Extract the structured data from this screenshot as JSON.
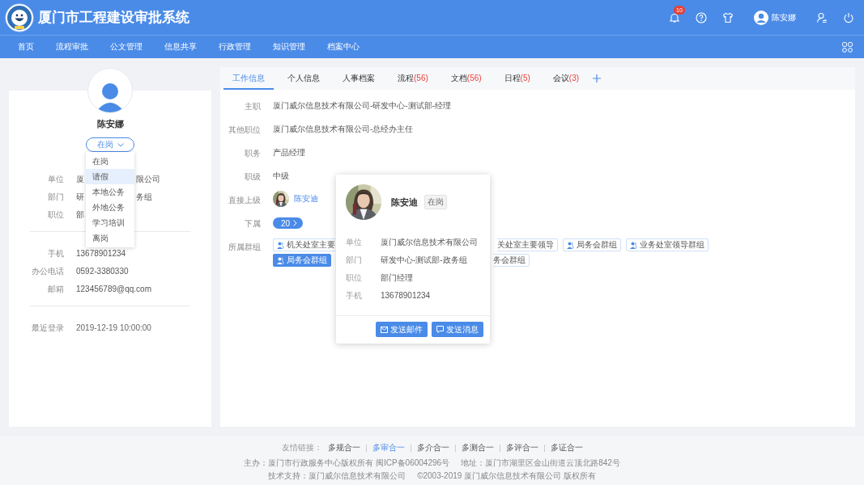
{
  "header": {
    "title": "厦门市工程建设审批系统",
    "notifications": "10",
    "user": "陈安娜"
  },
  "nav": {
    "items": [
      {
        "label": "首页"
      },
      {
        "label": "流程审批"
      },
      {
        "label": "公文管理"
      },
      {
        "label": "信息共享"
      },
      {
        "label": "行政管理"
      },
      {
        "label": "知识管理"
      },
      {
        "label": "档案中心"
      }
    ]
  },
  "profile": {
    "name": "陈安娜",
    "status": "在岗",
    "status_menu": {
      "options": [
        {
          "label": "在岗",
          "selected": false
        },
        {
          "label": "请假",
          "selected": true
        },
        {
          "label": "本地公务",
          "selected": false
        },
        {
          "label": "外地公务",
          "selected": false
        },
        {
          "label": "学习培训",
          "selected": false
        },
        {
          "label": "离岗",
          "selected": false
        }
      ]
    },
    "work_rows": [
      {
        "label": "单位",
        "value_start": "厦",
        "value_end": "限公司"
      },
      {
        "label": "部门",
        "value_start": "研",
        "value_end": "务组"
      },
      {
        "label": "职位",
        "value_start": "部"
      }
    ],
    "contact_rows": [
      {
        "label": "手机",
        "value": "13678901234"
      },
      {
        "label": "办公电话",
        "value": "0592-3380330"
      },
      {
        "label": "邮箱",
        "value": "123456789@qq.com"
      }
    ],
    "last_login": {
      "label": "最近登录",
      "value": "2019-12-19 10:00:00"
    }
  },
  "tabs": [
    {
      "label": "工作信息",
      "selected": true
    },
    {
      "label": "个人信息",
      "selected": false
    },
    {
      "label": "人事档案",
      "selected": false
    },
    {
      "label": "流程",
      "count": "(56)",
      "selected": false
    },
    {
      "label": "文档",
      "count": "(56)",
      "selected": false
    },
    {
      "label": "日程",
      "count": "(5)",
      "selected": false
    },
    {
      "label": "会议",
      "count": "(3)",
      "selected": false
    }
  ],
  "work_info": {
    "fields": [
      {
        "kind": "text",
        "label": "主职",
        "value": "厦门威尔信息技术有限公司-研发中心-测试部-经理"
      },
      {
        "kind": "text",
        "label": "其他职位",
        "value": "厦门威尔信息技术有限公司-总经办主任"
      },
      {
        "kind": "text",
        "label": "职务",
        "value": "产品经理"
      },
      {
        "kind": "text",
        "label": "职级",
        "value": "中级"
      },
      {
        "kind": "person",
        "label": "直接上级",
        "name": "陈安迪"
      },
      {
        "kind": "count",
        "label": "下属",
        "value": "20"
      },
      {
        "kind": "groups",
        "label": "所属群组",
        "rows": [
          {
            "left": [
              {
                "text": "机关处室主要",
                "kind": "cut-right",
                "selected": false
              }
            ],
            "right": [
              {
                "text": "关处室主要领导",
                "kind": "cut-left",
                "selected": false
              },
              {
                "text": "局务会群组",
                "kind": "full",
                "selected": false
              },
              {
                "text": "业务处室领导群组",
                "kind": "full",
                "selected": false
              }
            ]
          },
          {
            "left": [
              {
                "text": "局务会群组",
                "kind": "full",
                "selected": true
              }
            ],
            "right": [
              {
                "text": "务会群组",
                "kind": "cut-left",
                "selected": false
              }
            ]
          }
        ]
      }
    ]
  },
  "popover": {
    "name": "陈安迪",
    "status": "在岗",
    "rows": [
      {
        "label": "单位",
        "value": "厦门威尔信息技术有限公司"
      },
      {
        "label": "部门",
        "value": "研发中心-测试部-政务组"
      },
      {
        "label": "职位",
        "value": "部门经理"
      },
      {
        "label": "手机",
        "value": "13678901234"
      }
    ],
    "buttons": [
      {
        "label": "发送邮件",
        "kind": "mail"
      },
      {
        "label": "发送消息",
        "kind": "message"
      }
    ]
  },
  "footer": {
    "links_label": "友情链接：",
    "links": [
      {
        "label": "多规合一",
        "selected": false
      },
      {
        "label": "多审合一",
        "selected": true
      },
      {
        "label": "多介合一",
        "selected": false
      },
      {
        "label": "多测合一",
        "selected": false
      },
      {
        "label": "多评合一",
        "selected": false
      },
      {
        "label": "多证合一",
        "selected": false
      }
    ],
    "lines": [
      [
        "主办：厦门市行政服务中心版权所有 闽ICP备06004296号",
        "地址：厦门市湖里区金山街道云顶北路842号"
      ],
      [
        "技术支持：厦门威尔信息技术有限公司",
        "©2003-2019 厦门威尔信息技术有限公司 版权所有"
      ]
    ]
  }
}
